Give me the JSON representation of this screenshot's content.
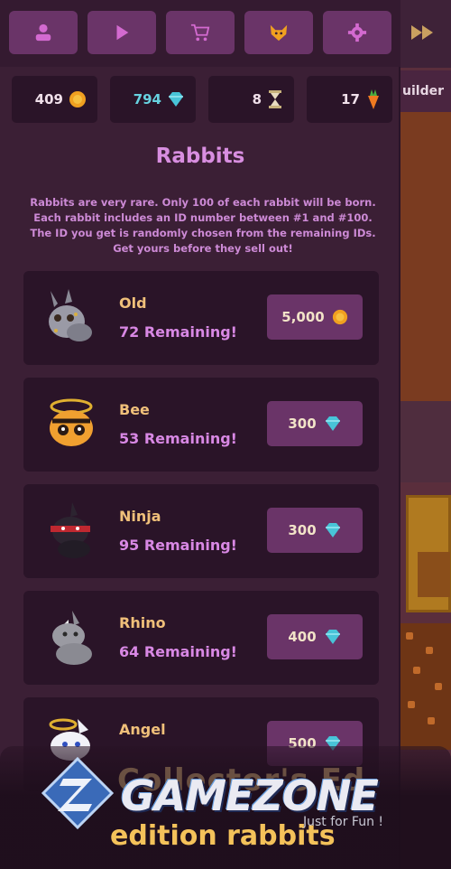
{
  "toolbar": {
    "buttons": [
      {
        "name": "profile",
        "icon": "person-icon"
      },
      {
        "name": "play",
        "icon": "play-icon"
      },
      {
        "name": "shop",
        "icon": "cart-icon"
      },
      {
        "name": "pet",
        "icon": "fox-face-icon"
      },
      {
        "name": "settings",
        "icon": "gear-icon"
      }
    ],
    "fast_forward_icon": "fast-forward-icon"
  },
  "resources": {
    "coins": "409",
    "gems": "794",
    "hourglass": "8",
    "carrots": "17"
  },
  "background": {
    "partial_label": "uilder"
  },
  "shop": {
    "title": "Rabbits",
    "description": "Rabbits are very rare. Only 100 of each rabbit will be born. Each rabbit includes an ID number between #1 and #100. The ID you get is randomly chosen from the remaining IDs. Get yours before they sell out!",
    "rabbits": [
      {
        "name": "Old",
        "remaining": "72 Remaining!",
        "price": "5,000",
        "currency": "coin"
      },
      {
        "name": "Bee",
        "remaining": "53 Remaining!",
        "price": "300",
        "currency": "gem"
      },
      {
        "name": "Ninja",
        "remaining": "95 Remaining!",
        "price": "300",
        "currency": "gem"
      },
      {
        "name": "Rhino",
        "remaining": "64 Remaining!",
        "price": "400",
        "currency": "gem"
      },
      {
        "name": "Angel",
        "remaining": "",
        "price": "500",
        "currency": "gem"
      }
    ]
  },
  "promo": {
    "logo_text": "GAMEZONE",
    "tagline": "Just for Fun !",
    "subtitle": "edition rabbits",
    "faded_line": "Collector's Ed"
  },
  "colors": {
    "accent_purple": "#6a3468",
    "title_pink": "#d88ee0",
    "name_gold": "#f0c07a",
    "gem_cyan": "#67d2e0",
    "coin_orange": "#f0a020"
  }
}
